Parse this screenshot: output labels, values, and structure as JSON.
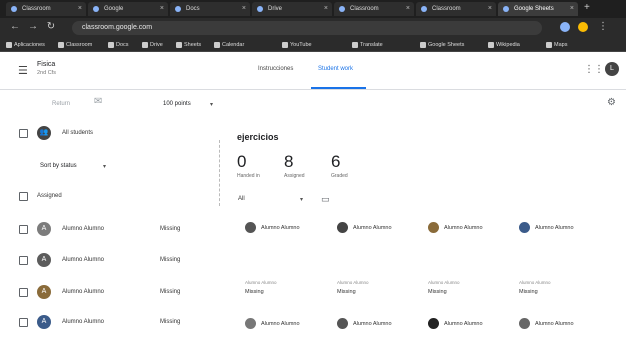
{
  "browser": {
    "tabs": [
      {
        "label": "Classroom"
      },
      {
        "label": "Google"
      },
      {
        "label": "Docs"
      },
      {
        "label": "Drive"
      },
      {
        "label": "Classroom"
      },
      {
        "label": "Classroom"
      },
      {
        "label": "Google Sheets",
        "active": true
      }
    ],
    "url": "classroom.google.com",
    "bookmarks": [
      "Aplicaciones",
      "Classroom",
      "Docs",
      "Drive",
      "Sheets",
      "Calendar",
      "YouTube",
      "Translate",
      "Google Sheets",
      "Wikipedia",
      "Maps"
    ]
  },
  "header": {
    "course_title": "Fisica",
    "course_subtitle": "2nd Cfs",
    "tabs": [
      {
        "label": "Instrucciones"
      },
      {
        "label": "Student work",
        "active": true
      }
    ],
    "avatar_initial": "L"
  },
  "toolbar": {
    "return_label": "Return",
    "points_select": "100 points",
    "points_arrow": "▾"
  },
  "sidebar": {
    "all_students_label": "All students",
    "sort_label": "Sort by status",
    "sort_arrow": "▾",
    "assigned_label": "Assigned",
    "students": [
      {
        "name": "Alumno Alumno",
        "status": "Missing",
        "initial": "A",
        "color": "#7c7c7c"
      },
      {
        "name": "Alumno Alumno",
        "status": "Missing",
        "initial": "A",
        "color": "#5c5c5c"
      },
      {
        "name": "Alumno Alumno",
        "status": "Missing",
        "initial": "A",
        "color": "#8a6b3a"
      },
      {
        "name": "Alumno Alumno",
        "status": "Missing",
        "initial": "A",
        "color": "#3b5b8a"
      }
    ]
  },
  "assignment": {
    "title": "ejercicios",
    "stats": [
      {
        "value": "0",
        "label": "Handed in"
      },
      {
        "value": "8",
        "label": "Assigned"
      },
      {
        "value": "6",
        "label": "Graded"
      }
    ],
    "filter_select": "All",
    "filter_arrow": "▾",
    "grid_row1": [
      {
        "name": "Alumno Alumno",
        "status": "",
        "sub": ""
      },
      {
        "name": "Alumno Alumno",
        "status": "",
        "sub": ""
      },
      {
        "name": "Alumno Alumno",
        "status": "",
        "sub": ""
      },
      {
        "name": "Alumno Alumno",
        "status": "",
        "sub": ""
      }
    ],
    "grid_row2": [
      {
        "name": "",
        "status": "Missing",
        "sub": "Alumno Alumno"
      },
      {
        "name": "",
        "status": "Missing",
        "sub": "Alumno Alumno"
      },
      {
        "name": "",
        "status": "Missing",
        "sub": "Alumno Alumno"
      },
      {
        "name": "",
        "status": "Missing",
        "sub": "Alumno Alumno"
      }
    ],
    "grid_row3": [
      {
        "name": "Alumno Alumno"
      },
      {
        "name": "Alumno Alumno"
      },
      {
        "name": "Alumno Alumno"
      },
      {
        "name": "Alumno Alumno"
      }
    ]
  },
  "icons": {
    "menu": "☰",
    "apps": "⋮⋮",
    "settings": "⚙",
    "folder": "▭",
    "checkbox": "",
    "back": "←",
    "forward": "→",
    "reload": "↻",
    "mail": "✉"
  }
}
